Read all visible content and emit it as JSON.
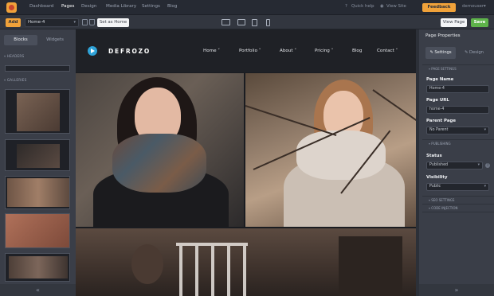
{
  "topnav": {
    "items": [
      "Dashboard",
      "Pages",
      "Design",
      "Media Library",
      "Settings",
      "Blog"
    ],
    "active": "Pages",
    "quick_help": "Quick help",
    "view_site": "View Site",
    "feedback": "Feedback",
    "user": "demouser"
  },
  "toolbar": {
    "add_label": "Add",
    "page_value": "Home-4",
    "set_home_label": "Set as Home",
    "view_page_label": "View Page",
    "save_label": "Save"
  },
  "left_panel": {
    "tabs": [
      "Blocks",
      "Widgets"
    ],
    "sections": [
      "HEADERS",
      "GALLERIES"
    ]
  },
  "site": {
    "logo": "DEFROZO",
    "nav": [
      "Home",
      "Portfolio",
      "About",
      "Pricing",
      "Blog",
      "Contact"
    ],
    "nav_has_dropdown": [
      true,
      true,
      true,
      true,
      false,
      true
    ]
  },
  "right_panel": {
    "title": "Page Properties",
    "tabs": [
      "Settings",
      "Design"
    ],
    "sections": {
      "page_settings": "PAGE SETTINGS",
      "publishing": "PUBLISHING",
      "seo_settings": "SEO SETTINGS",
      "code_injection": "CODE INJECTION"
    },
    "fields": {
      "page_name_label": "Page Name",
      "page_name_value": "Home-4",
      "page_url_label": "Page URL",
      "page_url_value": "home-4",
      "parent_page_label": "Parent Page",
      "parent_page_value": "No Parent",
      "status_label": "Status",
      "status_value": "Published",
      "visibility_label": "Visibility",
      "visibility_value": "Public"
    }
  },
  "colors": {
    "accent": "#f0a23a",
    "save": "#5eb34a",
    "logo_mark": "#2fa3d8"
  }
}
